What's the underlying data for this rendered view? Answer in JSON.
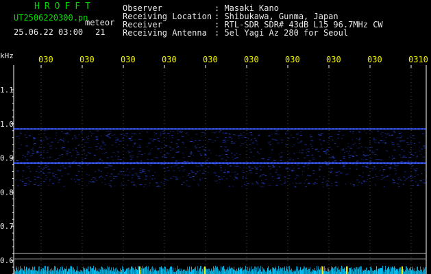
{
  "header": {
    "brand": "HROFFT",
    "filename": "UT2506220300.pn",
    "mode": "meteor",
    "date_time": "25.06.22 03:00",
    "count": "21",
    "labels": [
      "Observer",
      "Receiving Location",
      "Receiver",
      "Receiving Antenna"
    ],
    "values": [
      ": Masaki Kano",
      ": Shibukawa, Gunma, Japan",
      ": RTL-SDR SDR# 43dB L15 96.7MHz CW",
      ": 5el Yagi Az 280 for Seoul"
    ]
  },
  "colors": {
    "header_green": "#00e000",
    "header_white": "#e8e8e8",
    "time_labels": "#f0f000",
    "grid": "#ffffff",
    "signal_blue": "#3050ff",
    "noise_cyan": "#00c8ff"
  },
  "spectrogram": {
    "y_unit": "kHz",
    "y_ticks": [
      "1.1",
      "1.0",
      "0.9",
      "0.8",
      "0.7",
      "0.6"
    ],
    "y_tick_values": [
      1.1,
      1.0,
      0.9,
      0.8,
      0.7,
      0.6
    ],
    "y_range": [
      0.58,
      1.19
    ],
    "time_labels": [
      "030",
      "030",
      "030",
      "030",
      "030",
      "030",
      "030",
      "030",
      "030",
      "0310"
    ],
    "carrier_lines_khz": [
      0.985,
      0.885
    ],
    "noise_band_khz": [
      0.82,
      0.985
    ]
  }
}
